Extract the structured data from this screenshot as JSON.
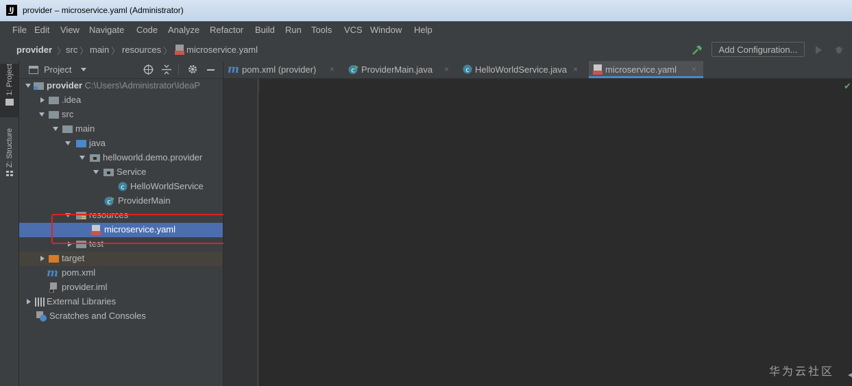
{
  "window": {
    "title": "provider – microservice.yaml (Administrator)"
  },
  "menu": [
    "File",
    "Edit",
    "View",
    "Navigate",
    "Code",
    "Analyze",
    "Refactor",
    "Build",
    "Run",
    "Tools",
    "VCS",
    "Window",
    "Help"
  ],
  "breadcrumb": [
    "provider",
    "src",
    "main",
    "resources",
    "microservice.yaml"
  ],
  "toolbar": {
    "add_config_label": "Add Configuration..."
  },
  "tool_windows": {
    "project": "1: Project",
    "structure": "Z: Structure"
  },
  "project_panel": {
    "title": "Project",
    "tree": [
      {
        "label": "provider",
        "path": "C:\\Users\\Administrator\\IdeaP"
      },
      {
        "label": ".idea"
      },
      {
        "label": "src"
      },
      {
        "label": "main"
      },
      {
        "label": "java"
      },
      {
        "label": "helloworld.demo.provider"
      },
      {
        "label": "Service"
      },
      {
        "label": "HelloWorldService"
      },
      {
        "label": "ProviderMain"
      },
      {
        "label": "resources"
      },
      {
        "label": "microservice.yaml"
      },
      {
        "label": "test"
      },
      {
        "label": "target"
      },
      {
        "label": "pom.xml"
      },
      {
        "label": "provider.iml"
      },
      {
        "label": "External Libraries"
      },
      {
        "label": "Scratches and Consoles"
      }
    ]
  },
  "editor_tabs": [
    {
      "label": "pom.xml (provider)"
    },
    {
      "label": "ProviderMain.java"
    },
    {
      "label": "HelloWorldService.java"
    },
    {
      "label": "microservice.yaml"
    }
  ],
  "colors": {
    "selection": "#4b6eaf",
    "highlight_box": "#e0231f",
    "active_tab_underline": "#4a88c7"
  },
  "watermark": "华为云社区"
}
